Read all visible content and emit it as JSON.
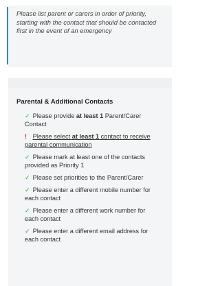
{
  "info": {
    "text": "Please list parent or carers in order of priority, starting with the contact that should be contacted first in the event of an emergency"
  },
  "panel": {
    "title": "Parental & Additional Contacts"
  },
  "checks": [
    {
      "status": "ok",
      "icon": "check-icon",
      "pre": "Please provide ",
      "bold": "at least 1",
      "post": " Parent/Carer Contact"
    },
    {
      "status": "error",
      "icon": "exclamation-icon",
      "pre": "Please select ",
      "bold": "at least 1",
      "post": " contact to receive parental communication"
    },
    {
      "status": "ok",
      "icon": "check-icon",
      "pre": "Please mark at least one of the contacts provided as Priority 1",
      "bold": "",
      "post": ""
    },
    {
      "status": "ok",
      "icon": "check-icon",
      "pre": "Please set priorities to the Parent/Carer",
      "bold": "",
      "post": ""
    },
    {
      "status": "ok",
      "icon": "check-icon",
      "pre": "Please enter a different mobile number for each contact",
      "bold": "",
      "post": ""
    },
    {
      "status": "ok",
      "icon": "check-icon",
      "pre": "Please enter a different work number for each contact",
      "bold": "",
      "post": ""
    },
    {
      "status": "ok",
      "icon": "check-icon",
      "pre": "Please enter a different email address for each contact",
      "bold": "",
      "post": ""
    }
  ],
  "colors": {
    "ok": "#2f9e3f",
    "error": "#e0231c",
    "info_bar": "#2a8ad6"
  }
}
